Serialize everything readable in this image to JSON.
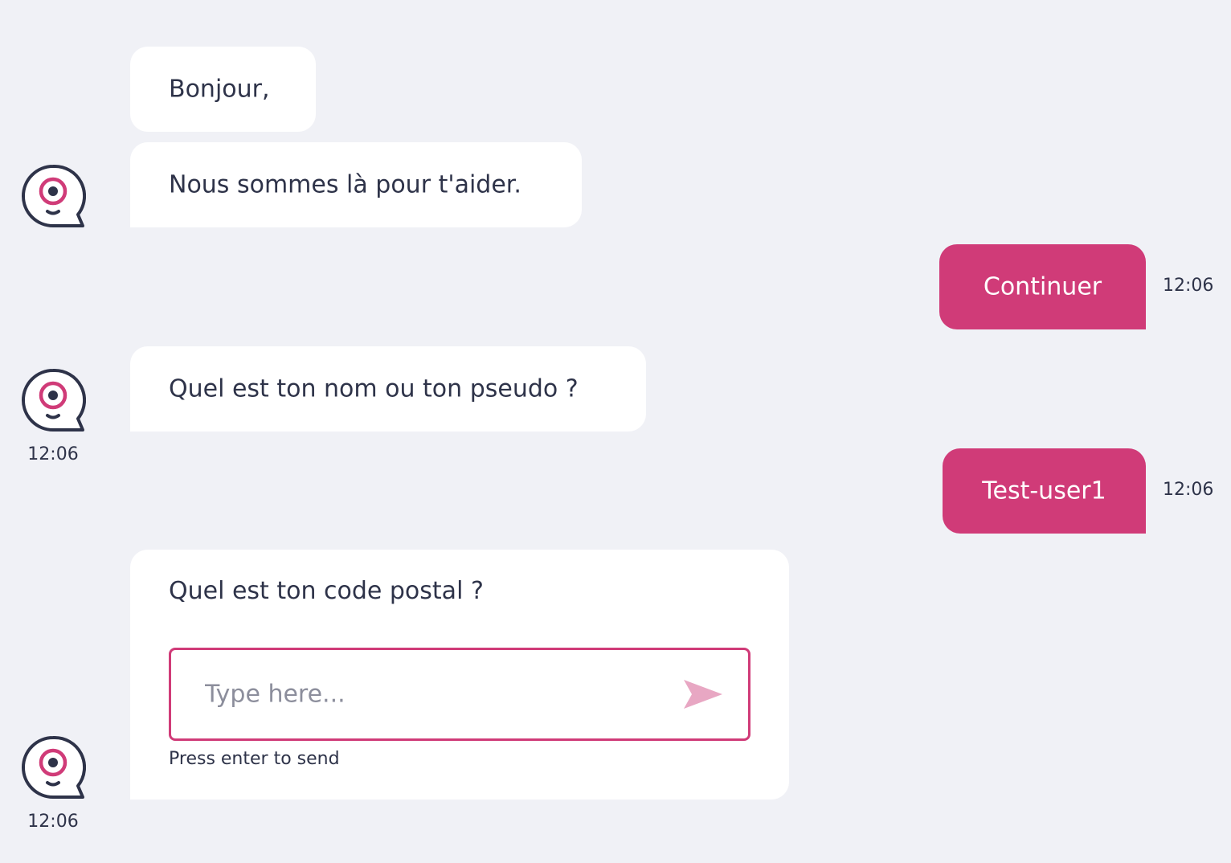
{
  "colors": {
    "background": "#f0f1f6",
    "bot_bubble": "#ffffff",
    "user_bubble": "#d03b78",
    "accent": "#d03b78",
    "text": "#2e3349"
  },
  "bot_avatar_icon": "chat-bubble-eye-icon",
  "messages": {
    "bot_1": {
      "text": "Bonjour,"
    },
    "bot_2": {
      "text": "Nous sommes là pour t'aider."
    },
    "user_1": {
      "text": "Continuer",
      "time": "12:06"
    },
    "bot_3": {
      "text": "Quel est ton nom ou ton pseudo ?",
      "time": "12:06"
    },
    "user_2": {
      "text": "Test-user1",
      "time": "12:06"
    },
    "bot_4": {
      "text": "Quel est ton code postal ?",
      "time": "12:06"
    }
  },
  "input": {
    "placeholder": "Type here...",
    "value": "",
    "hint": "Press enter to send",
    "send_icon": "send-icon"
  }
}
